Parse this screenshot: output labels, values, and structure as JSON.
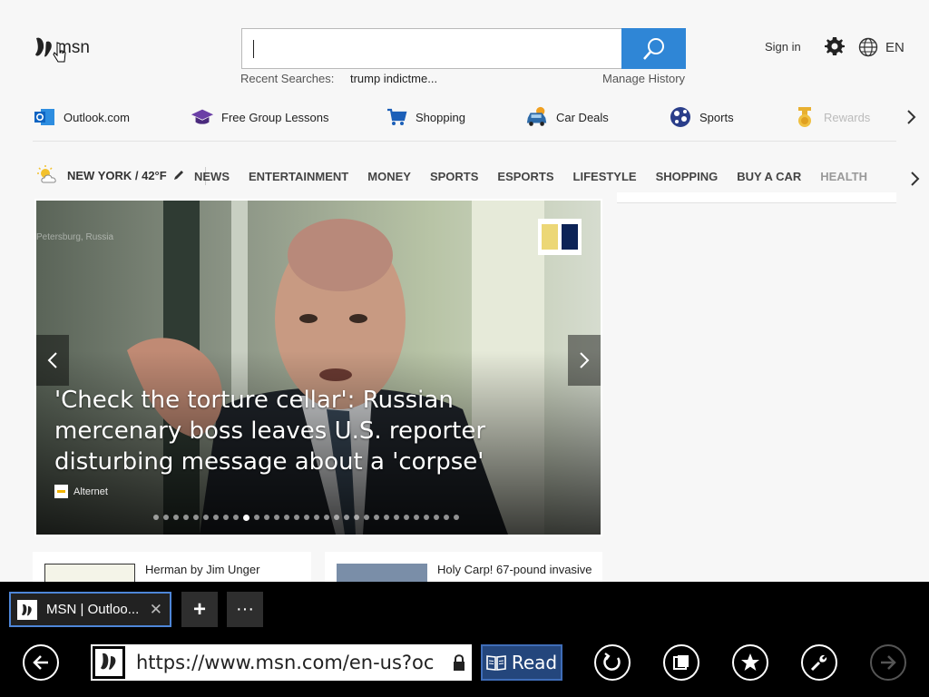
{
  "header": {
    "logo_text": "msn",
    "search_placeholder": "",
    "recent_label": "Recent Searches:",
    "recent_item": "trump indictme...",
    "manage_history": "Manage History",
    "sign_in": "Sign in",
    "language": "EN"
  },
  "quicklinks": [
    {
      "label": "Outlook.com",
      "icon": "outlook-icon"
    },
    {
      "label": "Free Group Lessons",
      "icon": "graduation-cap-icon"
    },
    {
      "label": "Shopping",
      "icon": "shopping-cart-icon"
    },
    {
      "label": "Car Deals",
      "icon": "car-icon"
    },
    {
      "label": "Sports",
      "icon": "sports-ball-icon"
    },
    {
      "label": "Rewards",
      "icon": "medal-icon"
    }
  ],
  "nav": {
    "weather": "NEW YORK / 42°F",
    "items": [
      "NEWS",
      "ENTERTAINMENT",
      "MONEY",
      "SPORTS",
      "ESPORTS",
      "LIFESTYLE",
      "SHOPPING",
      "BUY A CAR",
      "HEALTH"
    ]
  },
  "hero": {
    "title": "'Check the torture cellar': Russian mercenary boss leaves U.S. reporter disturbing message about a 'corpse'",
    "source": "Alternet",
    "watermark": "Petersburg, Russia",
    "dot_count": 31,
    "active_dot": 9
  },
  "cards": [
    {
      "title": "Herman by Jim Unger"
    },
    {
      "title": "Holy Carp! 67-pound invasive"
    }
  ],
  "browser": {
    "tab_title": "MSN | Outloo...",
    "tab_close": "✕",
    "new_tab": "+",
    "more_tabs": "···",
    "url": "https://www.msn.com/en-us?ocid=i",
    "read_label": "Read"
  },
  "colors": {
    "accent": "#2f86d6",
    "tab_border": "#4e86d8",
    "read_bg": "#24467c"
  }
}
